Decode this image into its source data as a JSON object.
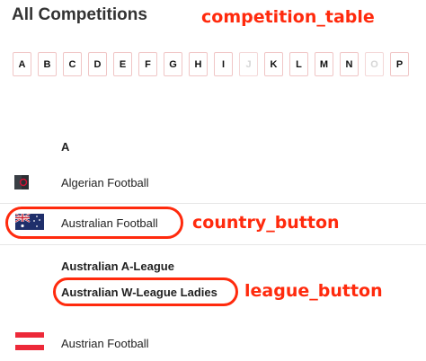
{
  "page": {
    "title": "All Competitions"
  },
  "annotations": {
    "table": "competition_table",
    "country": "country_button",
    "league": "league_button"
  },
  "alphabet": [
    {
      "letter": "A",
      "enabled": true
    },
    {
      "letter": "B",
      "enabled": true
    },
    {
      "letter": "C",
      "enabled": true
    },
    {
      "letter": "D",
      "enabled": true
    },
    {
      "letter": "E",
      "enabled": true
    },
    {
      "letter": "F",
      "enabled": true
    },
    {
      "letter": "G",
      "enabled": true
    },
    {
      "letter": "H",
      "enabled": true
    },
    {
      "letter": "I",
      "enabled": true
    },
    {
      "letter": "J",
      "enabled": false
    },
    {
      "letter": "K",
      "enabled": true
    },
    {
      "letter": "L",
      "enabled": true
    },
    {
      "letter": "M",
      "enabled": true
    },
    {
      "letter": "N",
      "enabled": true
    },
    {
      "letter": "O",
      "enabled": false
    },
    {
      "letter": "P",
      "enabled": true
    }
  ],
  "section": {
    "letter": "A"
  },
  "countries": {
    "algeria": {
      "label": "Algerian Football",
      "flag": "algeria-flag"
    },
    "australia": {
      "label": "Australian Football",
      "flag": "australia-flag"
    },
    "austria": {
      "label": "Austrian Football",
      "flag": "austria-flag"
    }
  },
  "leagues": {
    "a_league": "Australian A-League",
    "w_league": "Australian W-League Ladies"
  },
  "colors": {
    "accent": "#ff2a0d",
    "border": "#f0c6c6"
  }
}
